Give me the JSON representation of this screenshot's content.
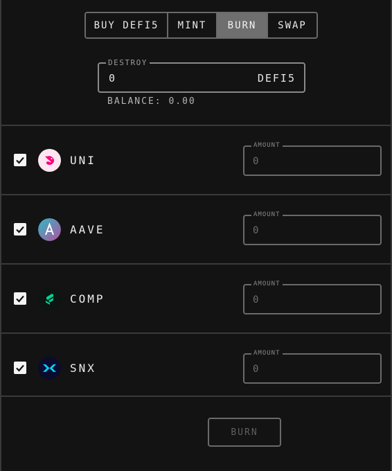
{
  "tabs": [
    "BUY DEFI5",
    "MINT",
    "BURN",
    "SWAP"
  ],
  "active_tab": "BURN",
  "destroy": {
    "label": "DESTROY",
    "value": "0",
    "unit": "DEFI5"
  },
  "balance": "BALANCE: 0.00",
  "tokens": [
    {
      "name": "UNI",
      "checked": true,
      "amount_label": "AMOUNT",
      "amount_placeholder": "0",
      "icon": "uniswap-unicorn-icon",
      "color": "#ff007a"
    },
    {
      "name": "AAVE",
      "checked": true,
      "amount_label": "AMOUNT",
      "amount_placeholder": "0",
      "icon": "aave-ghost-icon",
      "color": "#2ebac6"
    },
    {
      "name": "COMP",
      "checked": true,
      "amount_label": "AMOUNT",
      "amount_placeholder": "0",
      "icon": "compound-icon",
      "color": "#00d395"
    },
    {
      "name": "SNX",
      "checked": true,
      "amount_label": "AMOUNT",
      "amount_placeholder": "0",
      "icon": "synthetix-icon",
      "color": "#00d1ff"
    }
  ],
  "burn_button": "BURN"
}
